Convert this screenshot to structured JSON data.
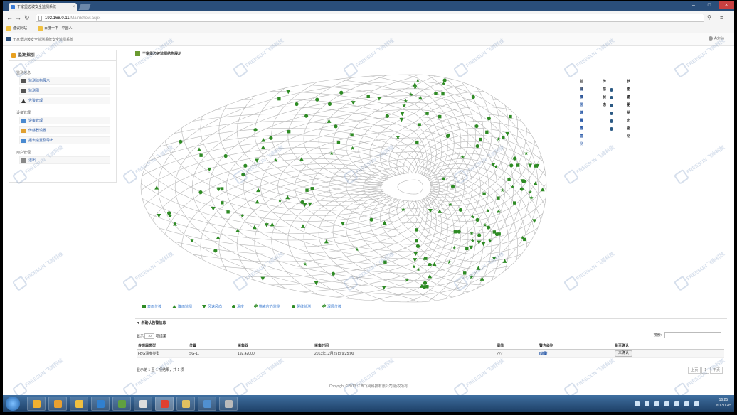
{
  "browser": {
    "tab_title": "干家堡边坡安全监测系统",
    "url_host": "192.168.0.11",
    "url_path": "/MainShow.aspx",
    "bookmarks": [
      "建议网站",
      "百度一下 · 中国人"
    ]
  },
  "header": {
    "breadcrumb": "干家堡边坡安全监测系统安全监测系统",
    "user": "Admin"
  },
  "sidebar": {
    "title": "监测指引",
    "groups": [
      {
        "label": "监测信息",
        "items": [
          "监测结构展示",
          "监测图",
          "告警管理"
        ]
      },
      {
        "label": "设备管理",
        "items": [
          "设备管理",
          "传感器设置",
          "报表设置及导出"
        ]
      },
      {
        "label": "用户管理",
        "items": [
          "退出"
        ]
      }
    ]
  },
  "content": {
    "title": "干家堡边坡监测结构展示"
  },
  "status_table": {
    "headers": [
      "监测项",
      "传感状态",
      "状态说明"
    ],
    "rows": [
      {
        "name": "温度",
        "state": "正常"
      },
      {
        "name": "表面位移",
        "state": "正常"
      },
      {
        "name": "风速风向",
        "state": "正常"
      },
      {
        "name": "锚索应力",
        "state": "状态正常"
      },
      {
        "name": "降雨监测",
        "state": "正常"
      },
      {
        "name": "湿度",
        "state": "正常"
      }
    ],
    "dot_color": "#2c5a84"
  },
  "chart_legend": [
    {
      "label": "表面位移",
      "shape": "square"
    },
    {
      "label": "降雨监测",
      "shape": "triangle"
    },
    {
      "label": "风速风向",
      "shape": "triangle-down"
    },
    {
      "label": "温度",
      "shape": "circle"
    },
    {
      "label": "锚索应力监测",
      "shape": "star"
    },
    {
      "label": "裂缝监测",
      "shape": "circle"
    },
    {
      "label": "深层位移",
      "shape": "star"
    }
  ],
  "marker_color": "#2e8b24",
  "panel": {
    "title": "未确认告警信息",
    "show_prefix": "显示",
    "show_value": "10",
    "show_suffix": "项结果",
    "search_label": "搜索:",
    "columns": [
      "传感器类型",
      "位置",
      "采集器",
      "采集时间",
      "阈值",
      "警告级别",
      "是否确认"
    ],
    "rows": [
      [
        "FBG温度类型",
        "SG-11",
        "192.42000",
        "2013年12月25日 9:25:00",
        "???",
        "I级警",
        "未确认"
      ]
    ],
    "page_info": "显示第 1 至 1 项结果，共 1 项",
    "pager": [
      "上页",
      "1",
      "下页"
    ]
  },
  "footer": "Copyright ©2013 江西飞尚科技有限公司 版权所有",
  "taskbar": {
    "time": "16:25",
    "date": "2013/12/5"
  },
  "watermark": {
    "brand": "FREESUN",
    "sub": "飞尚科技"
  }
}
